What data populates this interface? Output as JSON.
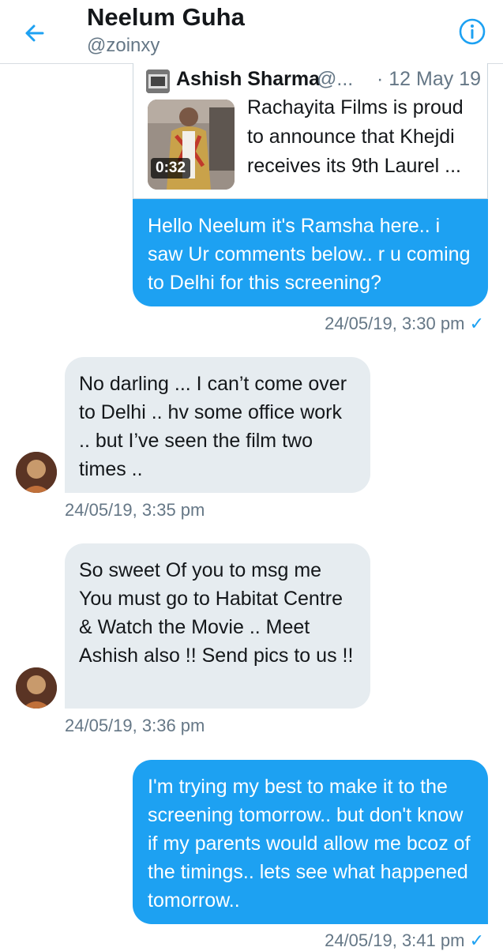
{
  "header": {
    "title": "Neelum Guha",
    "handle": "@zoinxy",
    "back_icon": "arrow-left-icon",
    "info_icon": "info-icon"
  },
  "shared_tweet": {
    "author_name": "Ashish Sharma",
    "author_handle": "@...",
    "date": "· 12 May 19",
    "video_duration": "0:32",
    "text": "Rachayita Films is proud to announce that Khejdi receives its 9th Laurel ..."
  },
  "messages": [
    {
      "id": "m1",
      "direction": "sent",
      "text": "Hello Neelum it's Ramsha here.. i saw Ur comments below.. r u coming to Delhi for this screening?",
      "timestamp": "24/05/19, 3:30 pm",
      "status": "✓"
    },
    {
      "id": "m2",
      "direction": "received",
      "text": "No darling ... I can’t come over to Delhi .. hv some office work .. but I’ve seen  the film two times ..",
      "timestamp": "24/05/19, 3:35 pm"
    },
    {
      "id": "m3",
      "direction": "received",
      "text": "So sweet Of you to msg me You must go to Habitat Centre & Watch the Movie .. Meet Ashish also !! Send pics to us !!",
      "timestamp": "24/05/19, 3:36 pm"
    },
    {
      "id": "m4",
      "direction": "sent",
      "text": "I'm trying my best to make it to the screening tomorrow.. but don't know if my parents would allow me bcoz of the timings.. lets see what happened tomorrow..",
      "timestamp": "24/05/19, 3:41 pm",
      "status": "✓"
    }
  ],
  "colors": {
    "accent": "#1da1f2",
    "received_bubble": "#e6ecf0",
    "secondary_text": "#657786",
    "primary_text": "#14171a"
  }
}
